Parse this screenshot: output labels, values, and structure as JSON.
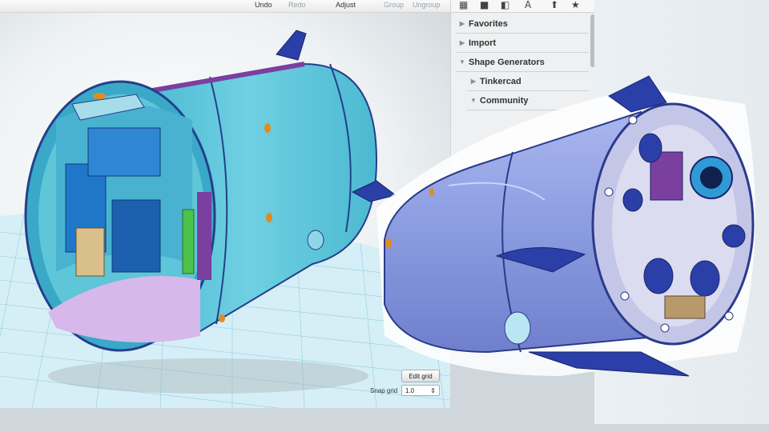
{
  "toolbar": {
    "undo": "Undo",
    "redo": "Redo",
    "adjust": "Adjust",
    "group": "Group",
    "ungroup": "Ungroup"
  },
  "sidebar": {
    "icons": [
      "box-icon",
      "cube-icon",
      "shapes-icon",
      "text-icon",
      "pin-icon",
      "star-icon"
    ],
    "items": [
      {
        "label": "Favorites",
        "expanded": false
      },
      {
        "label": "Import",
        "expanded": false
      },
      {
        "label": "Shape Generators",
        "expanded": true
      },
      {
        "label": "Tinkercad",
        "expanded": false
      },
      {
        "label": "Community",
        "expanded": true
      }
    ]
  },
  "grid_controls": {
    "edit_grid": "Edit grid",
    "snap_grid_label": "Snap grid",
    "snap_grid_value": "1.0"
  },
  "colors": {
    "capsule_outer": "#5ec6d8",
    "capsule_inner": "#3aa9c8",
    "interior_blue": "#1f77c9",
    "floor": "#d7b8ea",
    "accent_purple": "#7b3fa0",
    "fin_blue": "#2b3fa8",
    "render_body": "#8b9be0",
    "grid_line": "#7dc9e0"
  }
}
